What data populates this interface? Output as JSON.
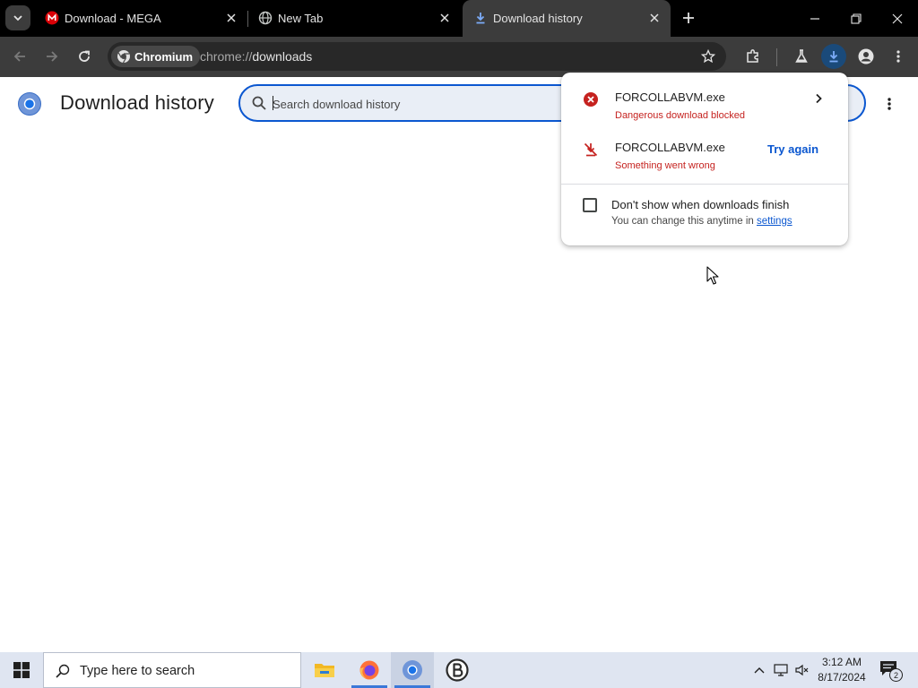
{
  "tabs": [
    {
      "title": "Download - MEGA",
      "favicon": "mega-icon"
    },
    {
      "title": "New Tab",
      "favicon": "globe-icon"
    },
    {
      "title": "Download history",
      "favicon": "download-icon",
      "active": true
    }
  ],
  "toolbar": {
    "chip_label": "Chromium",
    "url_scheme": "chrome://",
    "url_host": "downloads"
  },
  "page": {
    "title": "Download history",
    "search_placeholder": "Search download history"
  },
  "download_bubble": {
    "items": [
      {
        "filename": "FORCOLLABVM.exe",
        "status": "Dangerous download blocked",
        "icon": "error-circle-icon",
        "action": "chevron-right-icon"
      },
      {
        "filename": "FORCOLLABVM.exe",
        "status": "Something went wrong",
        "icon": "download-failed-icon",
        "action_label": "Try again"
      }
    ],
    "checkbox_label": "Don't show when downloads finish",
    "checkbox_checked": false,
    "sub_text": "You can change this anytime in ",
    "settings_link": "settings"
  },
  "taskbar": {
    "search_placeholder": "Type here to search",
    "time": "3:12 AM",
    "date": "8/17/2024",
    "notification_count": "2"
  },
  "colors": {
    "accent": "#0b57d0",
    "error": "#c5221f",
    "tabstrip": "#000000",
    "toolbar": "#3c3c3c"
  }
}
